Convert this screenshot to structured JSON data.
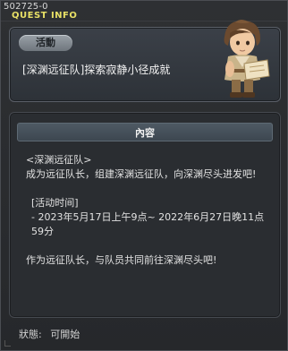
{
  "window": {
    "quest_id": "502725-0",
    "title": "QUEST INFO"
  },
  "header": {
    "tag": "活動",
    "quest_name": "[深渊远征队]探索寂静小径成就",
    "npc_icon": "adventurer-npc-portrait"
  },
  "content": {
    "header": "內容",
    "section_title": "<深渊远征队>",
    "description": "成为远征队长，组建深渊远征队，向深渊尽头进发吧!",
    "event_label": "[活动时间]",
    "event_time": "- 2023年5月17日上午9点~ 2022年6月27日晚11点59分",
    "closing": "作为远征队长，与队员共同前往深渊尽头吧!"
  },
  "status": {
    "label": "狀態:",
    "value": "可開始"
  },
  "colors": {
    "title": "#e8e066",
    "panel_bg": "#2a2d31",
    "header_bar": "#4e5a64"
  }
}
